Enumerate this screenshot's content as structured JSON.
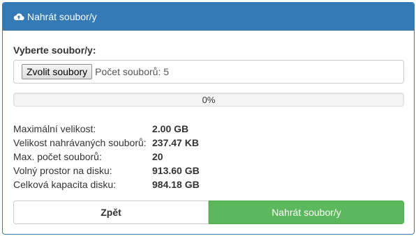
{
  "header": {
    "icon": "cloud-upload-icon",
    "title": "Nahrát soubor/y"
  },
  "form": {
    "label": "Vyberte soubor/y:",
    "choose_button": "Zvolit soubory",
    "file_count_text": "Počet souborů: 5"
  },
  "progress": {
    "value": 0,
    "label": "0%"
  },
  "info": [
    {
      "label": "Maximální velikost:",
      "value": "2.00 GB"
    },
    {
      "label": "Velikost nahrávaných souborů:",
      "value": "237.47 KB"
    },
    {
      "label": "Max. počet souborů:",
      "value": "20"
    },
    {
      "label": "Volný prostor na disku:",
      "value": "913.60 GB"
    },
    {
      "label": "Celková kapacita disku:",
      "value": "984.18 GB"
    }
  ],
  "buttons": {
    "back": "Zpět",
    "upload": "Nahrát soubor/y"
  },
  "colors": {
    "primary": "#337ab7",
    "success": "#5cb85c"
  }
}
